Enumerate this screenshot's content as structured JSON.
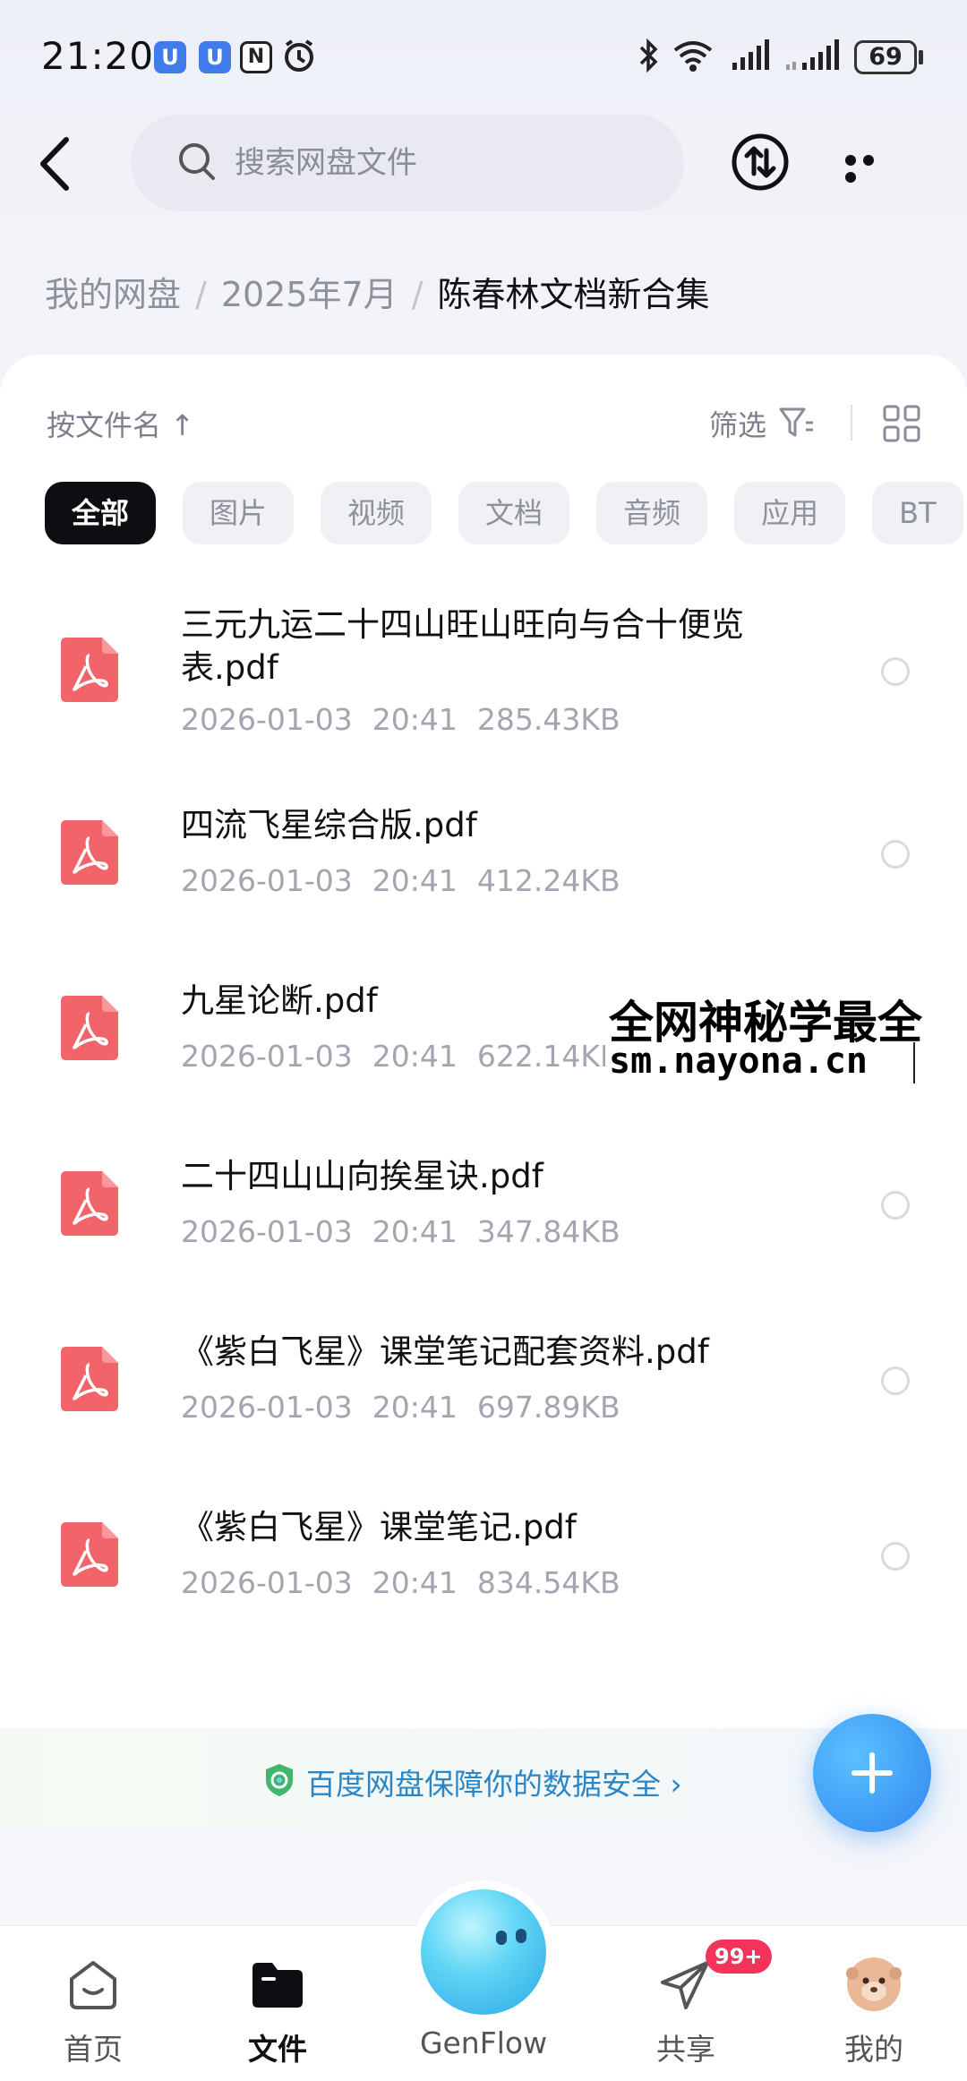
{
  "status_bar": {
    "time": "21:20",
    "battery": "69",
    "notification_icons": [
      "app-icon",
      "app-icon",
      "nfc-icon",
      "alarm-icon"
    ]
  },
  "header": {
    "search_placeholder": "搜索网盘文件"
  },
  "breadcrumb": [
    "我的网盘",
    "2025年7月",
    "陈春林文档新合集"
  ],
  "toolbar": {
    "sort_label": "按文件名",
    "sort_arrow": "↑",
    "filter_label": "筛选"
  },
  "filter_tabs": [
    "全部",
    "图片",
    "视频",
    "文档",
    "音频",
    "应用",
    "BT"
  ],
  "files": [
    {
      "name": "三元九运二十四山旺山旺向与合十便览表.pdf",
      "date": "2026-01-03",
      "time": "20:41",
      "size": "285.43KB"
    },
    {
      "name": "四流飞星综合版.pdf",
      "date": "2026-01-03",
      "time": "20:41",
      "size": "412.24KB"
    },
    {
      "name": "九星论断.pdf",
      "date": "2026-01-03",
      "time": "20:41",
      "size": "622.14KB"
    },
    {
      "name": "二十四山山向挨星诀.pdf",
      "date": "2026-01-03",
      "time": "20:41",
      "size": "347.84KB"
    },
    {
      "name": "《紫白飞星》课堂笔记配套资料.pdf",
      "date": "2026-01-03",
      "time": "20:41",
      "size": "697.89KB"
    },
    {
      "name": "《紫白飞星》课堂笔记.pdf",
      "date": "2026-01-03",
      "time": "20:41",
      "size": "834.54KB"
    }
  ],
  "watermark": {
    "line1": "全网神秘学最全",
    "line2": "sm.nayona.cn"
  },
  "safety_text": "百度网盘保障你的数据安全 ›",
  "bottom_nav": {
    "home": "首页",
    "files": "文件",
    "genflow": "GenFlow",
    "share": "共享",
    "share_badge": "99+",
    "mine": "我的"
  },
  "colors": {
    "accent": "#2f87f0",
    "pdf_red": "#f0646a",
    "badge": "#f5335a"
  }
}
